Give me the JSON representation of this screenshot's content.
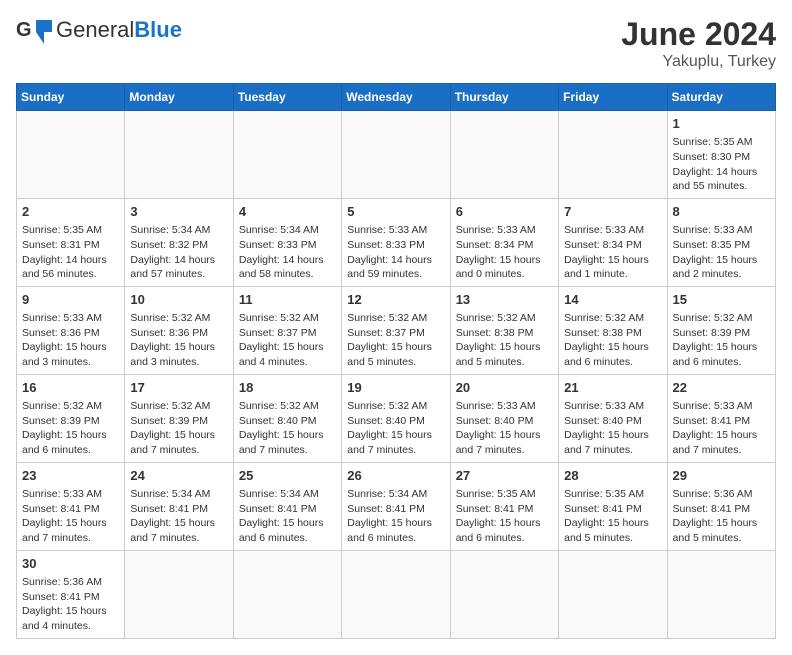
{
  "header": {
    "logo_general": "General",
    "logo_blue": "Blue",
    "title": "June 2024",
    "subtitle": "Yakuplu, Turkey"
  },
  "weekdays": [
    "Sunday",
    "Monday",
    "Tuesday",
    "Wednesday",
    "Thursday",
    "Friday",
    "Saturday"
  ],
  "weeks": [
    [
      {
        "day": "",
        "info": ""
      },
      {
        "day": "",
        "info": ""
      },
      {
        "day": "",
        "info": ""
      },
      {
        "day": "",
        "info": ""
      },
      {
        "day": "",
        "info": ""
      },
      {
        "day": "",
        "info": ""
      },
      {
        "day": "1",
        "info": "Sunrise: 5:35 AM\nSunset: 8:30 PM\nDaylight: 14 hours and 55 minutes."
      }
    ],
    [
      {
        "day": "2",
        "info": "Sunrise: 5:35 AM\nSunset: 8:31 PM\nDaylight: 14 hours and 56 minutes."
      },
      {
        "day": "3",
        "info": "Sunrise: 5:34 AM\nSunset: 8:32 PM\nDaylight: 14 hours and 57 minutes."
      },
      {
        "day": "4",
        "info": "Sunrise: 5:34 AM\nSunset: 8:33 PM\nDaylight: 14 hours and 58 minutes."
      },
      {
        "day": "5",
        "info": "Sunrise: 5:33 AM\nSunset: 8:33 PM\nDaylight: 14 hours and 59 minutes."
      },
      {
        "day": "6",
        "info": "Sunrise: 5:33 AM\nSunset: 8:34 PM\nDaylight: 15 hours and 0 minutes."
      },
      {
        "day": "7",
        "info": "Sunrise: 5:33 AM\nSunset: 8:34 PM\nDaylight: 15 hours and 1 minute."
      },
      {
        "day": "8",
        "info": "Sunrise: 5:33 AM\nSunset: 8:35 PM\nDaylight: 15 hours and 2 minutes."
      }
    ],
    [
      {
        "day": "9",
        "info": "Sunrise: 5:33 AM\nSunset: 8:36 PM\nDaylight: 15 hours and 3 minutes."
      },
      {
        "day": "10",
        "info": "Sunrise: 5:32 AM\nSunset: 8:36 PM\nDaylight: 15 hours and 3 minutes."
      },
      {
        "day": "11",
        "info": "Sunrise: 5:32 AM\nSunset: 8:37 PM\nDaylight: 15 hours and 4 minutes."
      },
      {
        "day": "12",
        "info": "Sunrise: 5:32 AM\nSunset: 8:37 PM\nDaylight: 15 hours and 5 minutes."
      },
      {
        "day": "13",
        "info": "Sunrise: 5:32 AM\nSunset: 8:38 PM\nDaylight: 15 hours and 5 minutes."
      },
      {
        "day": "14",
        "info": "Sunrise: 5:32 AM\nSunset: 8:38 PM\nDaylight: 15 hours and 6 minutes."
      },
      {
        "day": "15",
        "info": "Sunrise: 5:32 AM\nSunset: 8:39 PM\nDaylight: 15 hours and 6 minutes."
      }
    ],
    [
      {
        "day": "16",
        "info": "Sunrise: 5:32 AM\nSunset: 8:39 PM\nDaylight: 15 hours and 6 minutes."
      },
      {
        "day": "17",
        "info": "Sunrise: 5:32 AM\nSunset: 8:39 PM\nDaylight: 15 hours and 7 minutes."
      },
      {
        "day": "18",
        "info": "Sunrise: 5:32 AM\nSunset: 8:40 PM\nDaylight: 15 hours and 7 minutes."
      },
      {
        "day": "19",
        "info": "Sunrise: 5:32 AM\nSunset: 8:40 PM\nDaylight: 15 hours and 7 minutes."
      },
      {
        "day": "20",
        "info": "Sunrise: 5:33 AM\nSunset: 8:40 PM\nDaylight: 15 hours and 7 minutes."
      },
      {
        "day": "21",
        "info": "Sunrise: 5:33 AM\nSunset: 8:40 PM\nDaylight: 15 hours and 7 minutes."
      },
      {
        "day": "22",
        "info": "Sunrise: 5:33 AM\nSunset: 8:41 PM\nDaylight: 15 hours and 7 minutes."
      }
    ],
    [
      {
        "day": "23",
        "info": "Sunrise: 5:33 AM\nSunset: 8:41 PM\nDaylight: 15 hours and 7 minutes."
      },
      {
        "day": "24",
        "info": "Sunrise: 5:34 AM\nSunset: 8:41 PM\nDaylight: 15 hours and 7 minutes."
      },
      {
        "day": "25",
        "info": "Sunrise: 5:34 AM\nSunset: 8:41 PM\nDaylight: 15 hours and 6 minutes."
      },
      {
        "day": "26",
        "info": "Sunrise: 5:34 AM\nSunset: 8:41 PM\nDaylight: 15 hours and 6 minutes."
      },
      {
        "day": "27",
        "info": "Sunrise: 5:35 AM\nSunset: 8:41 PM\nDaylight: 15 hours and 6 minutes."
      },
      {
        "day": "28",
        "info": "Sunrise: 5:35 AM\nSunset: 8:41 PM\nDaylight: 15 hours and 5 minutes."
      },
      {
        "day": "29",
        "info": "Sunrise: 5:36 AM\nSunset: 8:41 PM\nDaylight: 15 hours and 5 minutes."
      }
    ],
    [
      {
        "day": "30",
        "info": "Sunrise: 5:36 AM\nSunset: 8:41 PM\nDaylight: 15 hours and 4 minutes."
      },
      {
        "day": "",
        "info": ""
      },
      {
        "day": "",
        "info": ""
      },
      {
        "day": "",
        "info": ""
      },
      {
        "day": "",
        "info": ""
      },
      {
        "day": "",
        "info": ""
      },
      {
        "day": "",
        "info": ""
      }
    ]
  ]
}
